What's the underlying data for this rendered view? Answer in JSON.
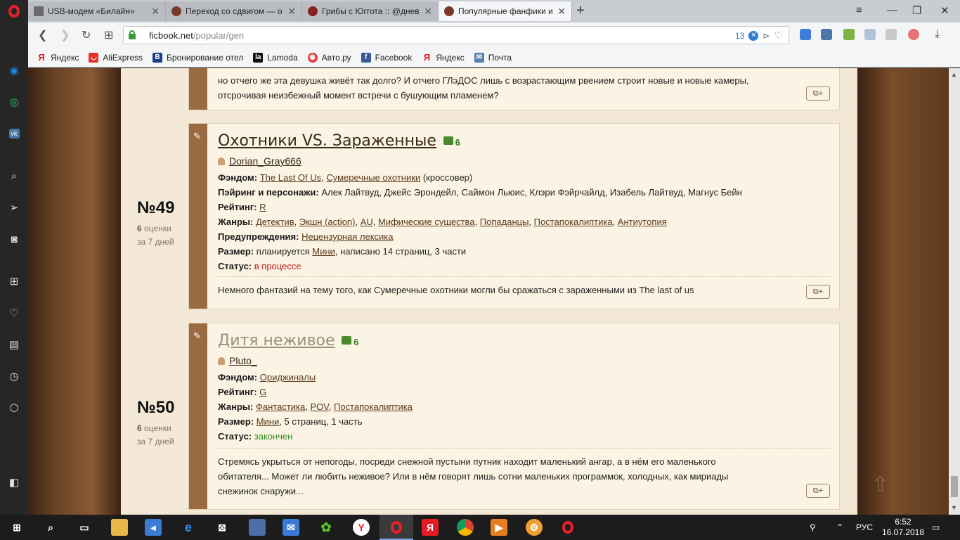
{
  "browser": {
    "tabs": [
      {
        "title": "USB-модем «Билайн»",
        "favicon": "modem-icon"
      },
      {
        "title": "Переход со сдвигом — о",
        "favicon": "quill-icon"
      },
      {
        "title": "Грибы с Юггота :: @днев",
        "favicon": "diary-icon"
      },
      {
        "title": "Популярные фанфики и ф",
        "favicon": "quill-icon",
        "active": true
      }
    ],
    "url_host": "ficbook.net",
    "url_path": "/popular/gen",
    "url_badge_count": "13",
    "bookmarks": [
      {
        "label": "Яндекс",
        "icon": "yandex-icon"
      },
      {
        "label": "AliExpress",
        "icon": "aliexpress-icon"
      },
      {
        "label": "Бронирование отел",
        "icon": "booking-icon"
      },
      {
        "label": "Lamoda",
        "icon": "lamoda-icon"
      },
      {
        "label": "Авто.ру",
        "icon": "autoru-icon"
      },
      {
        "label": "Facebook",
        "icon": "facebook-icon"
      },
      {
        "label": "Яндекс",
        "icon": "yandex-icon"
      },
      {
        "label": "Почта",
        "icon": "mail-icon"
      }
    ]
  },
  "prev_card": {
    "desc_line1": "но отчего же эта девушка живёт так долго? И отчего ГЛэДОС лишь с возрастающим рвением строит новые и новые камеры,",
    "desc_line2": "отсрочивая неизбежный момент встречи с бушующим пламенем?",
    "add_label": "⧉+"
  },
  "cards": [
    {
      "rank": "№49",
      "ratings_count": "6",
      "ratings_word": "оценки",
      "period": "за 7 дней",
      "title": "Охотники VS. Зараженные",
      "likes": "6",
      "author": "Dorian_Gray666",
      "fandom_label": "Фэндом:",
      "fandom_1": "The Last Of Us",
      "fandom_2": "Сумеречные охотники",
      "fandom_note": "(кроссовер)",
      "pairing_label": "Пэйринг и персонажи:",
      "pairing": "Алек Лайтвуд, Джейс Эрондейл, Саймон Льюис, Клэри Фэйрчайлд, Изабель Лайтвуд, Магнус Бейн",
      "rating_label": "Рейтинг:",
      "rating": "R",
      "genres_label": "Жанры:",
      "genres": [
        "Детектив",
        "Экшн (action)",
        "AU",
        "Мифические существа",
        "Попаданцы",
        "Постапокалиптика",
        "Антиутопия"
      ],
      "warnings_label": "Предупреждения:",
      "warnings": "Нецензурная лексика",
      "size_label": "Размер:",
      "size_pre": "планируется",
      "size_link": "Мини",
      "size_post": ", написано 14 страниц, 3 части",
      "status_label": "Статус:",
      "status": "в процессе",
      "desc": "Немного фантазий на тему того, как Сумеречные охотники могли бы сражаться с зараженными из The last of us"
    },
    {
      "rank": "№50",
      "ratings_count": "6",
      "ratings_word": "оценки",
      "period": "за 7 дней",
      "title": "Дитя неживое",
      "likes": "6",
      "author": "Pluto_",
      "fandom_label": "Фэндом:",
      "fandom_1": "Ориджиналы",
      "rating_label": "Рейтинг:",
      "rating": "G",
      "genres_label": "Жанры:",
      "genres": [
        "Фантастика",
        "POV",
        "Постапокалиптика"
      ],
      "size_label": "Размер:",
      "size_link": "Мини",
      "size_post": ", 5 страниц, 1 часть",
      "status_label": "Статус:",
      "status": "закончен",
      "desc_line1": "Стремясь укрыться от непогоды, посреди снежной пустыни путник находит маленький ангар, а в нём его маленького",
      "desc_line2": "обитателя... Может ли любить неживое? Или в нём говорят лишь сотни маленьких программок, холодных, как мириады",
      "desc_line3": "снежинок снаружи..."
    }
  ],
  "taskbar": {
    "language": "РУС",
    "time": "6:52",
    "date": "16.07.2018"
  },
  "colors": {
    "accent_brown": "#9a6a40",
    "status_red": "#c41a1a",
    "status_green": "#2e8b1c",
    "opera_red": "#e8202b"
  }
}
